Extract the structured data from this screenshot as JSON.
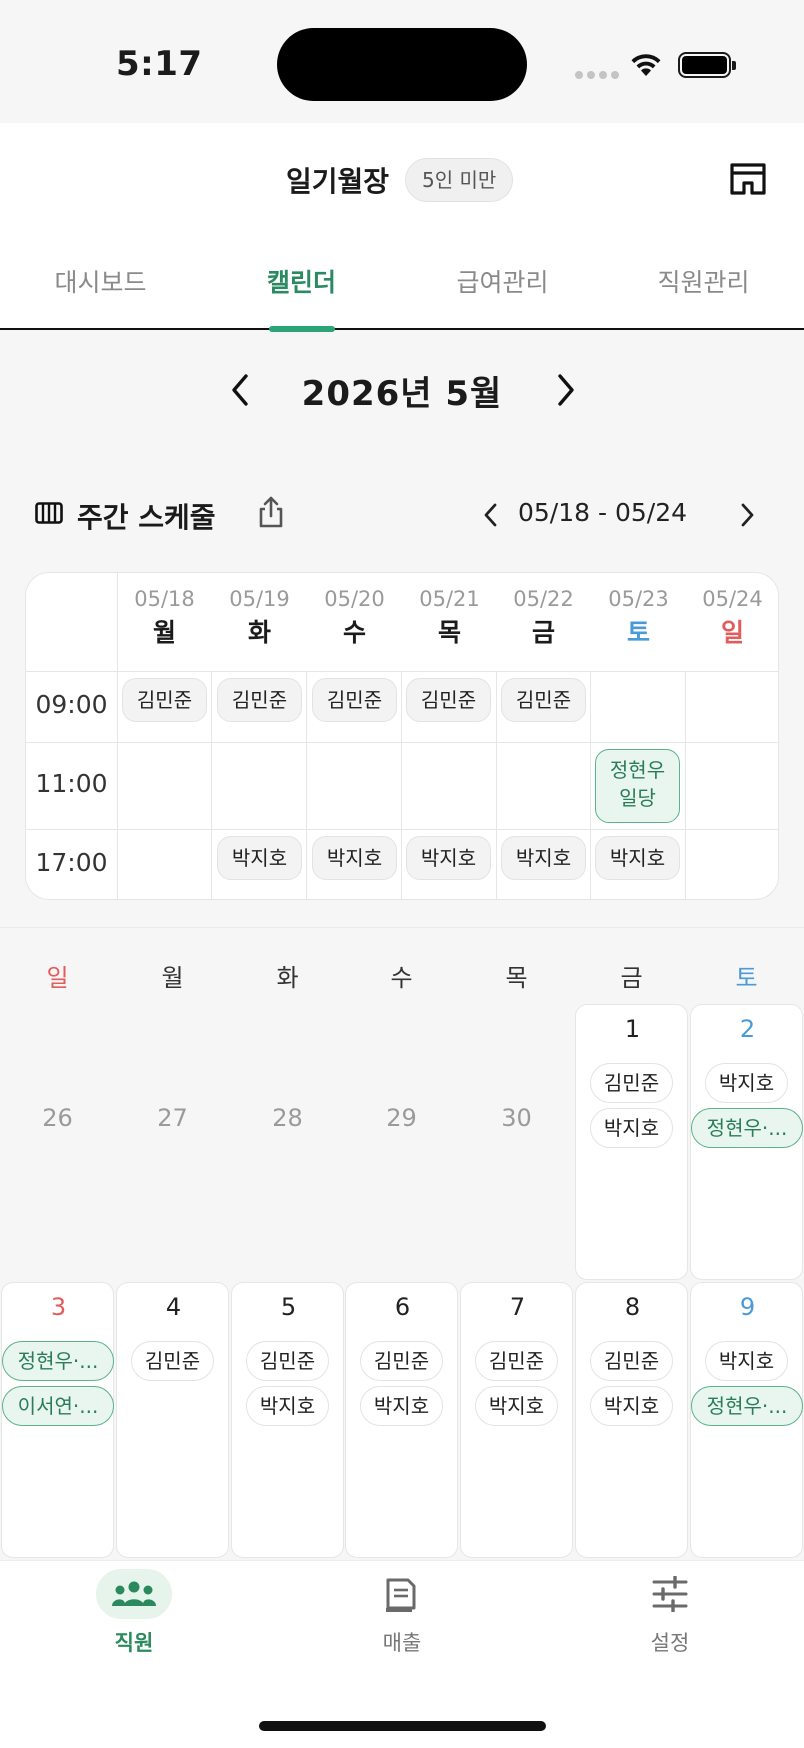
{
  "status_bar": {
    "time": "5:17"
  },
  "header": {
    "store_name": "일기월장",
    "store_badge": "5인 미만",
    "tabs": [
      {
        "label": "대시보드",
        "active": false
      },
      {
        "label": "캘린더",
        "active": true
      },
      {
        "label": "급여관리",
        "active": false
      },
      {
        "label": "직원관리",
        "active": false
      }
    ]
  },
  "month_nav": {
    "title": "2026년 5월"
  },
  "weekly": {
    "title": "주간 스케줄",
    "range": "05/18 - 05/24",
    "days": [
      {
        "date": "05/18",
        "day": "월"
      },
      {
        "date": "05/19",
        "day": "화"
      },
      {
        "date": "05/20",
        "day": "수"
      },
      {
        "date": "05/21",
        "day": "목"
      },
      {
        "date": "05/22",
        "day": "금"
      },
      {
        "date": "05/23",
        "day": "토"
      },
      {
        "date": "05/24",
        "day": "일"
      }
    ],
    "slots": [
      {
        "time": "09:00",
        "chips": [
          "김민준",
          "김민준",
          "김민준",
          "김민준",
          "김민준"
        ]
      },
      {
        "time": "11:00",
        "chips": [
          "정현우",
          "일당"
        ]
      },
      {
        "time": "17:00",
        "chips": [
          "박지호",
          "박지호",
          "박지호",
          "박지호",
          "박지호"
        ]
      }
    ]
  },
  "monthly": {
    "weekdays": [
      "일",
      "월",
      "화",
      "수",
      "목",
      "금",
      "토"
    ],
    "week1": [
      {
        "num": "26"
      },
      {
        "num": "27"
      },
      {
        "num": "28"
      },
      {
        "num": "29"
      },
      {
        "num": "30"
      },
      {
        "num": "1",
        "chips": [
          "김민준",
          "박지호"
        ]
      },
      {
        "num": "2",
        "chips": [
          "박지호",
          "정현우·..."
        ]
      }
    ],
    "week2": [
      {
        "num": "3",
        "chips": [
          "정현우·...",
          "이서연·..."
        ]
      },
      {
        "num": "4",
        "chips": [
          "김민준"
        ]
      },
      {
        "num": "5",
        "chips": [
          "김민준",
          "박지호"
        ]
      },
      {
        "num": "6",
        "chips": [
          "김민준",
          "박지호"
        ]
      },
      {
        "num": "7",
        "chips": [
          "김민준",
          "박지호"
        ]
      },
      {
        "num": "8",
        "chips": [
          "김민준",
          "박지호"
        ]
      },
      {
        "num": "9",
        "chips": [
          "박지호",
          "정현우·..."
        ]
      }
    ]
  },
  "bottom_nav": [
    {
      "label": "직원",
      "icon": "people-icon",
      "active": true
    },
    {
      "label": "매출",
      "icon": "receipt-icon",
      "active": false
    },
    {
      "label": "설정",
      "icon": "sliders-icon",
      "active": false
    }
  ],
  "colors": {
    "accent": "#2ba577",
    "saturday": "#4a9ad8",
    "sunday": "#e35c5c"
  }
}
